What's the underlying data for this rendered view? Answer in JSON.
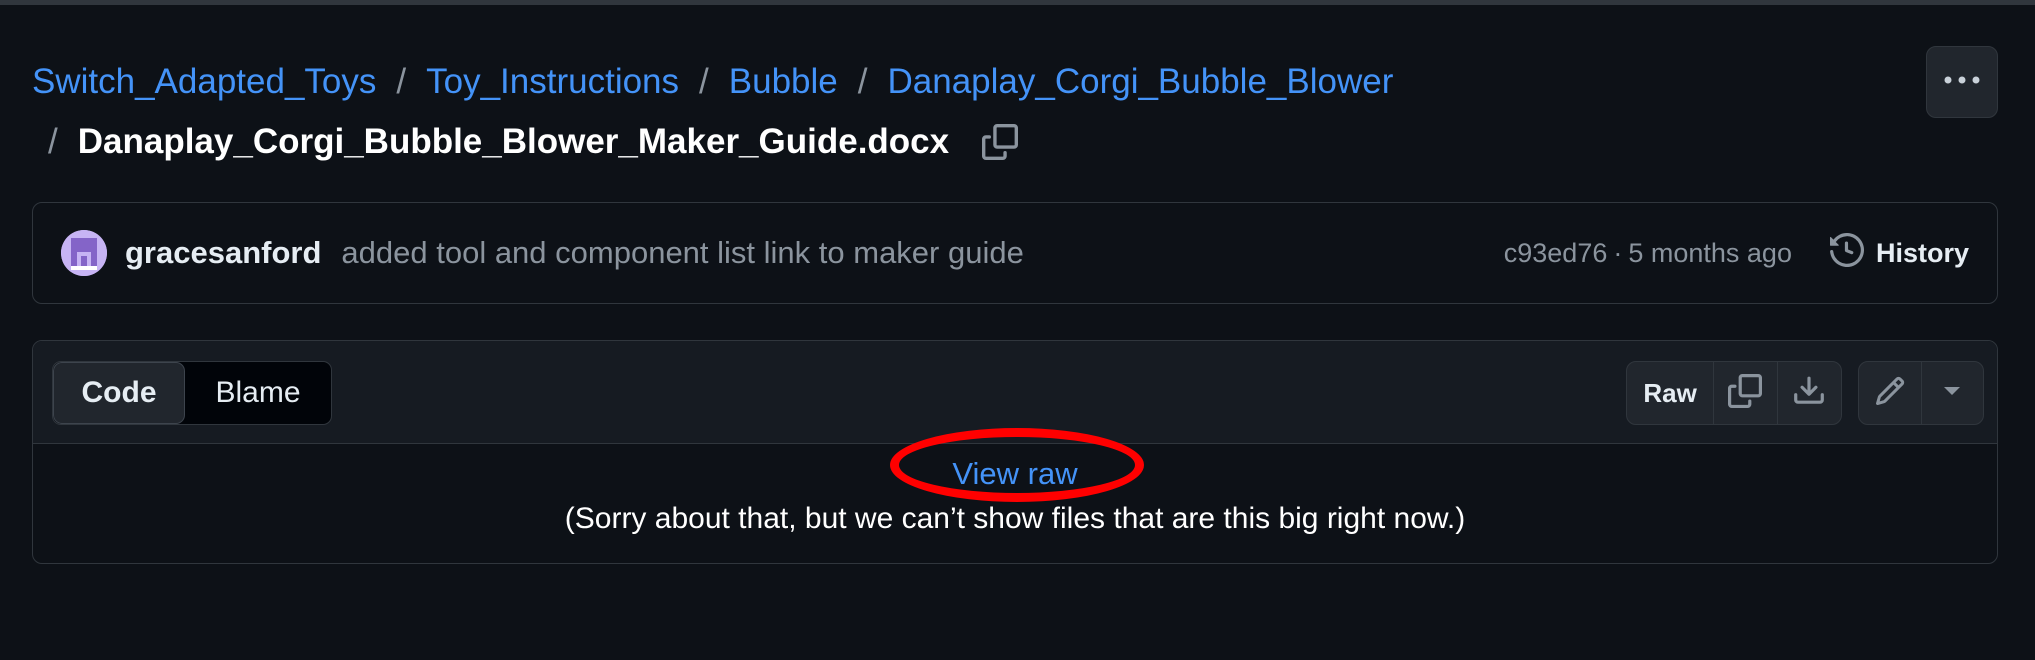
{
  "breadcrumb": {
    "links": [
      "Switch_Adapted_Toys",
      "Toy_Instructions",
      "Bubble",
      "Danaplay_Corgi_Bubble_Blower"
    ],
    "separator": "/",
    "file": "Danaplay_Corgi_Bubble_Blower_Maker_Guide.docx"
  },
  "commit": {
    "author": "gracesanford",
    "message": "added tool and component list link to maker guide",
    "sha": "c93ed76",
    "dot": "·",
    "age": "5 months ago",
    "history_label": "History"
  },
  "file_header": {
    "tabs": [
      "Code",
      "Blame"
    ],
    "active_tab": "Code",
    "raw_label": "Raw"
  },
  "file_body": {
    "view_raw": "View raw",
    "message": "(Sorry about that, but we can’t show files that are this big right now.)"
  },
  "colors": {
    "background": "#0d1117",
    "link": "#4493f8",
    "muted": "#8b949e",
    "border": "#30363d",
    "annotation": "#ff0000"
  },
  "icons": [
    "copy-icon",
    "kebab-icon",
    "history-icon",
    "download-icon",
    "pencil-icon",
    "triangle-down-icon"
  ]
}
